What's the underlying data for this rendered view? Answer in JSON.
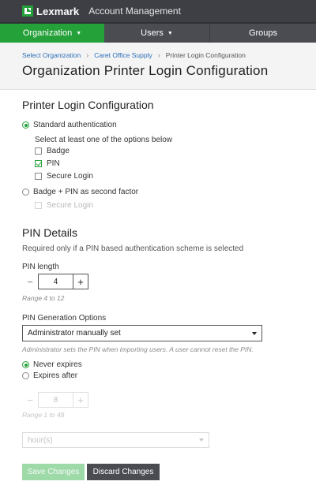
{
  "brand": {
    "name": "Lexmark",
    "app_title": "Account Management"
  },
  "nav": {
    "tabs": [
      {
        "label": "Organization",
        "has_caret": true,
        "active": true
      },
      {
        "label": "Users",
        "has_caret": true,
        "active": false
      },
      {
        "label": "Groups",
        "has_caret": false,
        "active": false
      }
    ]
  },
  "breadcrumb": {
    "items": [
      "Select Organization",
      "Caret Office Supply"
    ],
    "current": "Printer Login Configuration"
  },
  "page_title": "Organization Printer Login Configuration",
  "login_config": {
    "title": "Printer Login Configuration",
    "standard_auth_label": "Standard authentication",
    "instruction": "Select at least one of the options below",
    "options": [
      {
        "label": "Badge",
        "checked": false
      },
      {
        "label": "PIN",
        "checked": true
      },
      {
        "label": "Secure Login",
        "checked": false
      }
    ],
    "second_factor_label": "Badge + PIN as second factor",
    "second_factor_options": [
      {
        "label": "Secure Login",
        "checked": false,
        "disabled": true
      }
    ]
  },
  "pin_details": {
    "title": "PIN Details",
    "subtitle": "Required only if a PIN based authentication scheme is selected",
    "pin_length_label": "PIN length",
    "pin_length_value": "4",
    "pin_length_range": "Range 4 to 12",
    "generation_label": "PIN Generation Options",
    "generation_value": "Administrator manually set",
    "generation_hint": "Administrator sets the PIN when importing users. A user cannot reset the PIN.",
    "never_expires_label": "Never expires",
    "expires_after_label": "Expires after",
    "expiry_value": "8",
    "expiry_range": "Range 1 to 48",
    "expiry_unit": "hour(s)"
  },
  "actions": {
    "save_label": "Save Changes",
    "discard_label": "Discard Changes"
  },
  "colors": {
    "accent": "#25a13a",
    "topbar": "#3d3f45",
    "link": "#2d6fb8"
  }
}
